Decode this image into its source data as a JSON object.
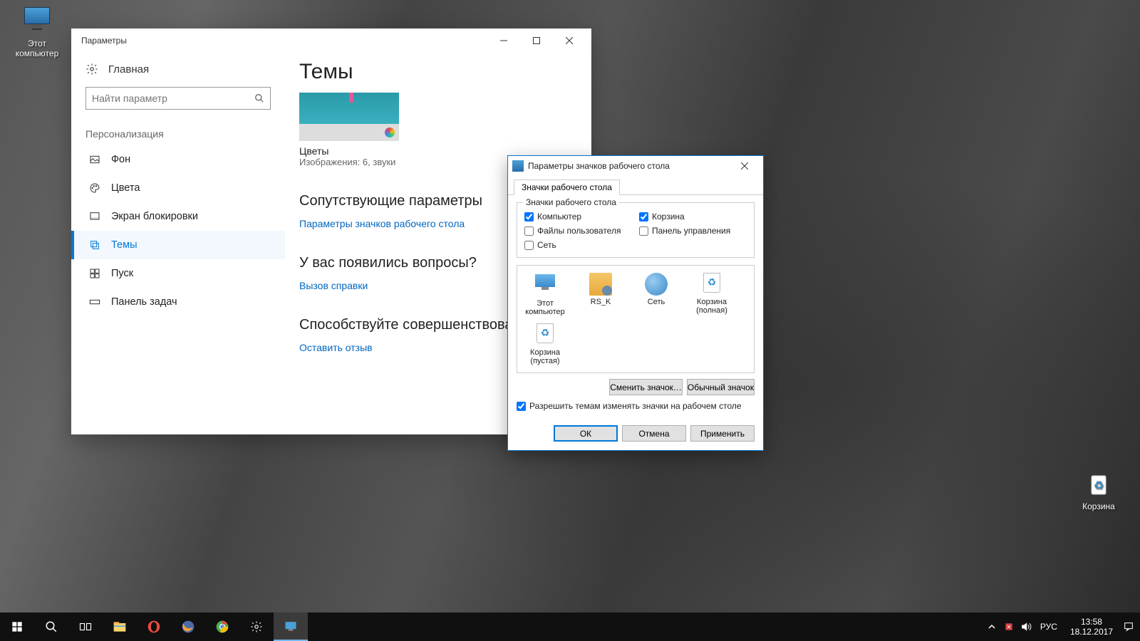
{
  "desktop": {
    "this_pc": "Этот\nкомпьютер",
    "recycle": "Корзина"
  },
  "settings": {
    "title": "Параметры",
    "home": "Главная",
    "search_placeholder": "Найти параметр",
    "section": "Персонализация",
    "nav": {
      "background": "Фон",
      "colors": "Цвета",
      "lockscreen": "Экран блокировки",
      "themes": "Темы",
      "start": "Пуск",
      "taskbar": "Панель задач"
    },
    "content": {
      "heading": "Темы",
      "theme_name": "Цветы",
      "theme_meta": "Изображения: 6, звуки",
      "related_heading": "Сопутствующие параметры",
      "related_link": "Параметры значков рабочего стола",
      "help_heading": "У вас появились вопросы?",
      "help_link": "Вызов справки",
      "feedback_heading": "Способствуйте совершенствованию",
      "feedback_link": "Оставить отзыв"
    }
  },
  "dialog": {
    "title": "Параметры значков рабочего стола",
    "tab": "Значки рабочего стола",
    "group_title": "Значки рабочего стола",
    "checks": {
      "computer": "Компьютер",
      "recycle": "Корзина",
      "userfiles": "Файлы пользователя",
      "cpanel": "Панель управления",
      "network": "Сеть"
    },
    "icons": {
      "pc": "Этот\nкомпьютер",
      "user": "RS_K",
      "net": "Сеть",
      "bin_full": "Корзина\n(полная)",
      "bin_empty": "Корзина\n(пустая)"
    },
    "btn_change": "Сменить значок…",
    "btn_default": "Обычный значок",
    "allow_themes": "Разрешить темам изменять значки на рабочем столе",
    "ok": "ОК",
    "cancel": "Отмена",
    "apply": "Применить"
  },
  "taskbar": {
    "lang": "РУС",
    "time": "13:58",
    "date": "18.12.2017"
  }
}
